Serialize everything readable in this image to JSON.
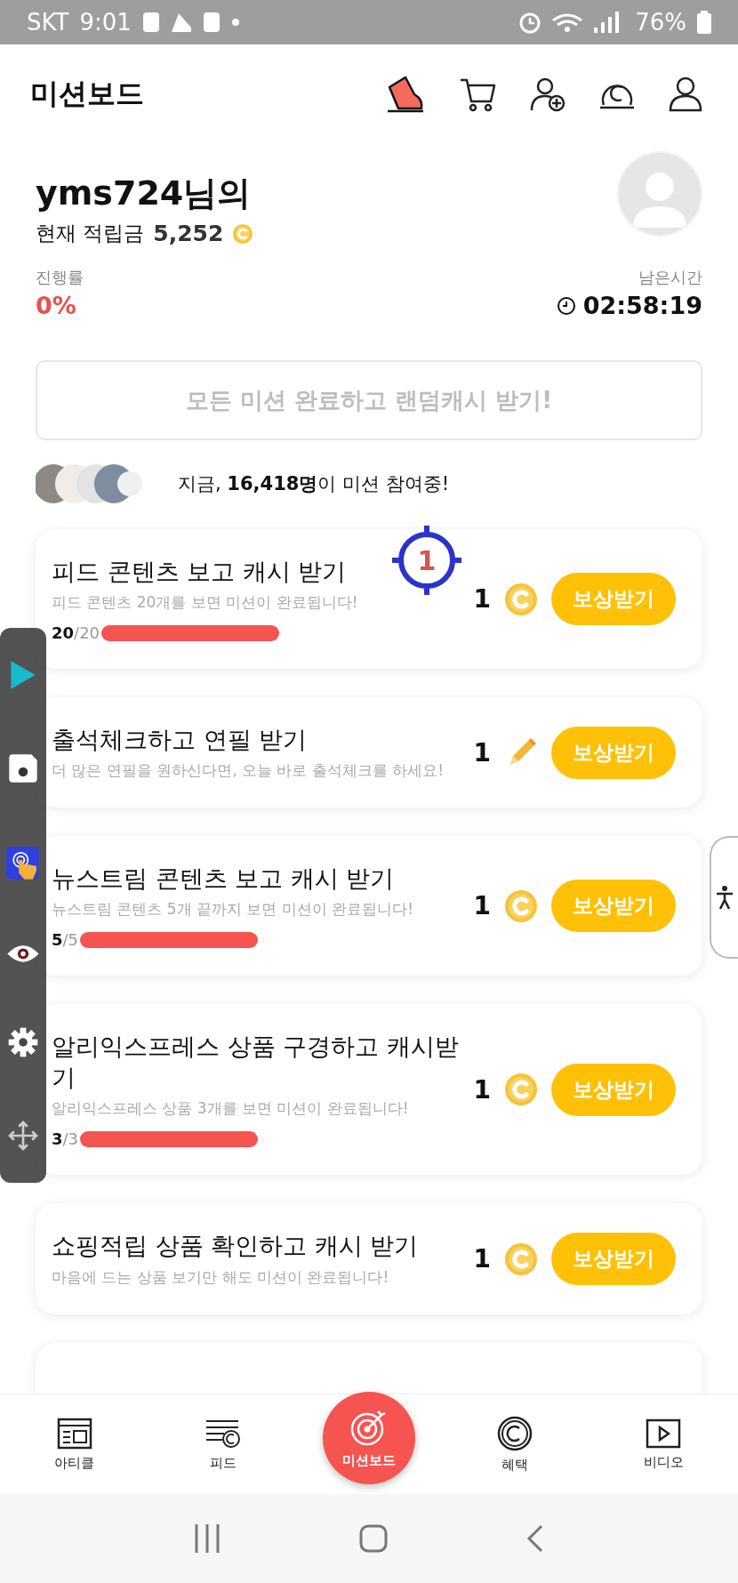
{
  "status_bar": {
    "carrier": "SKT",
    "time": "9:01",
    "battery": "76%"
  },
  "header": {
    "title": "미션보드"
  },
  "profile": {
    "greeting": "yms724님의",
    "balance_label": "현재 적립금",
    "balance": "5,252",
    "progress_label": "진행률",
    "progress": "0%",
    "time_label": "남은시간",
    "time_left": "02:58:19"
  },
  "all_missions_button": "모든 미션 완료하고 랜덤캐시 받기!",
  "participants": "지금, **16,418명**이 미션 참여중!",
  "missions": [
    {
      "title": "피드 콘텐츠 보고 캐시 받기",
      "description": "피드 콘텐츠 20개를 보면 미션이 완료됩니다!",
      "reward": "1",
      "kind": "coin",
      "button": "보상받기",
      "progress": {
        "count": "**20**/20",
        "level": 1
      }
    },
    {
      "title": "출석체크하고 연필 받기",
      "description": "더 많은 연필을 원하신다면, 오늘 바로 출석체크를 하세요!",
      "reward": "1",
      "kind": "pencil",
      "button": "보상받기"
    },
    {
      "title": "뉴스트림 콘텐츠 보고 캐시 받기",
      "description": "뉴스트림 콘텐츠 5개 끝까지 보면 미션이 완료됩니다!",
      "reward": "1",
      "kind": "coin",
      "button": "보상받기",
      "progress": {
        "count": "**5**/5",
        "level": 1
      }
    },
    {
      "title": "알리익스프레스 상품 구경하고 캐시받기",
      "description": "알리익스프레스 상품 3개를 보면 미션이 완료됩니다!",
      "reward": "1",
      "kind": "coin",
      "button": "보상받기",
      "progress": {
        "count": "**3**/3",
        "level": 1
      }
    },
    {
      "title": "쇼핑적립 상품 확인하고 캐시 받기",
      "description": "마음에 드는 상품 보기만 해도 미션이 완료됩니다!",
      "reward": "1",
      "kind": "coin",
      "button": "보상받기"
    }
  ],
  "bottom_nav": [
    {
      "label": "아티클",
      "kind": "article",
      "selected": false
    },
    {
      "label": "피드",
      "kind": "feed",
      "selected": false
    },
    {
      "label": "미션보드",
      "kind": "target",
      "selected": true
    },
    {
      "label": "혜택",
      "kind": "benefit",
      "selected": false
    },
    {
      "label": "비디오",
      "kind": "video",
      "selected": false
    }
  ],
  "tap_target": {
    "number": "1"
  }
}
